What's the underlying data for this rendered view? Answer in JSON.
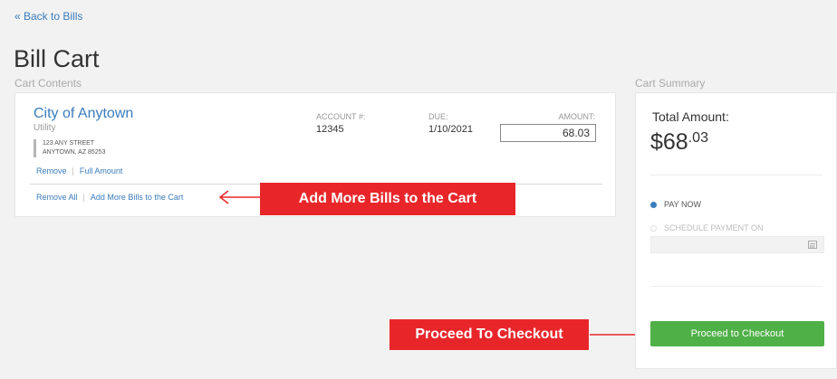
{
  "nav": {
    "back_label": "« Back to Bills"
  },
  "page": {
    "title": "Bill Cart",
    "cart_contents_heading": "Cart Contents",
    "cart_summary_heading": "Cart Summary"
  },
  "bill": {
    "payee": "City of Anytown",
    "type": "Utility",
    "address_line1": "123 ANY STREET",
    "address_line2": "ANYTOWN, AZ 85253",
    "account_label": "ACCOUNT #:",
    "account_value": "12345",
    "due_label": "DUE:",
    "due_value": "1/10/2021",
    "amount_label": "AMOUNT:",
    "amount_value": "68.03",
    "remove_label": "Remove",
    "full_amount_label": "Full Amount"
  },
  "cart_actions": {
    "remove_all_label": "Remove All",
    "add_more_label": "Add More Bills to the Cart"
  },
  "callouts": {
    "add_more": "Add More Bills to the Cart",
    "checkout": "Proceed To Checkout"
  },
  "summary": {
    "total_label": "Total Amount:",
    "total_dollars": "$68",
    "total_cents": ".03",
    "pay_now_label": "PAY NOW",
    "schedule_label": "SCHEDULE PAYMENT ON",
    "checkout_label": "Proceed to Checkout"
  },
  "colors": {
    "link": "#3a7cbc",
    "callout": "#e8262a",
    "checkout_button": "#4fb047"
  }
}
